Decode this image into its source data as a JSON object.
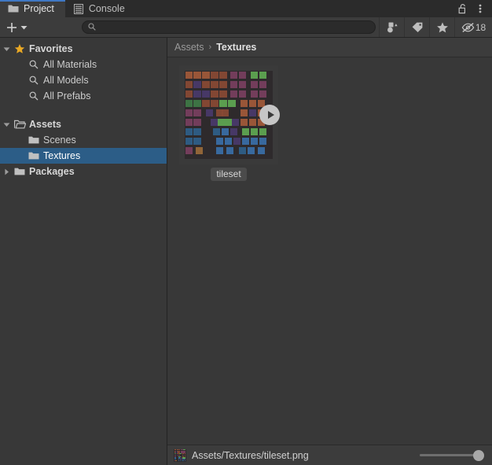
{
  "window": {
    "tabs": [
      {
        "label": "Project",
        "icon": "folder-icon",
        "active": true
      },
      {
        "label": "Console",
        "icon": "console-lines-icon",
        "active": false
      }
    ],
    "lock_icon": "unlocked-padlock-icon",
    "menu_icon": "kebab-menu-icon"
  },
  "toolbar": {
    "add_label": "+",
    "add_dropdown_icon": "chevron-down-icon",
    "search": {
      "value": "",
      "placeholder": "",
      "icon": "search-icon"
    },
    "filters": [
      {
        "name": "filter-by-type-icon",
        "label": ""
      },
      {
        "name": "filter-by-label-icon",
        "label": ""
      },
      {
        "name": "filter-by-favorite-icon",
        "label": ""
      }
    ],
    "hidden_counter": {
      "icon": "eye-slash-icon",
      "count": "18"
    }
  },
  "sidebar": {
    "items": [
      {
        "label": "Favorites",
        "icon": "star-icon",
        "arrow": "down",
        "depth": 0,
        "bold": true,
        "selected": false
      },
      {
        "label": "All Materials",
        "icon": "search-icon",
        "arrow": "none",
        "depth": 1,
        "bold": false,
        "selected": false
      },
      {
        "label": "All Models",
        "icon": "search-icon",
        "arrow": "none",
        "depth": 1,
        "bold": false,
        "selected": false
      },
      {
        "label": "All Prefabs",
        "icon": "search-icon",
        "arrow": "none",
        "depth": 1,
        "bold": false,
        "selected": false
      },
      {
        "label": "Assets",
        "icon": "folder-open-icon",
        "arrow": "down",
        "depth": 0,
        "bold": true,
        "selected": false
      },
      {
        "label": "Scenes",
        "icon": "folder-icon",
        "arrow": "none",
        "depth": 1,
        "bold": false,
        "selected": false
      },
      {
        "label": "Textures",
        "icon": "folder-icon",
        "arrow": "none",
        "depth": 1,
        "bold": false,
        "selected": true
      },
      {
        "label": "Packages",
        "icon": "folder-icon",
        "arrow": "right",
        "depth": 0,
        "bold": true,
        "selected": false
      }
    ]
  },
  "breadcrumb": {
    "root": "Assets",
    "separator": "›",
    "current": "Textures"
  },
  "assets": [
    {
      "name": "tileset",
      "selected": true,
      "has_subassets": true,
      "expand_icon": "play-triangle-icon"
    }
  ],
  "status": {
    "path": "Assets/Textures/tileset.png",
    "thumb_icon": "tileset-thumbnail-icon",
    "zoom_slider": {
      "value": "100",
      "min": "0",
      "max": "100"
    }
  },
  "colors": {
    "accent_tab": "#3f78c4",
    "selection": "#2c5d87",
    "panel_bg": "#383838",
    "toolbar_bg": "#3c3c3c",
    "tabbar_bg": "#2b2b2b",
    "favorite_star": "#e8a825",
    "text": "#cccccc"
  }
}
